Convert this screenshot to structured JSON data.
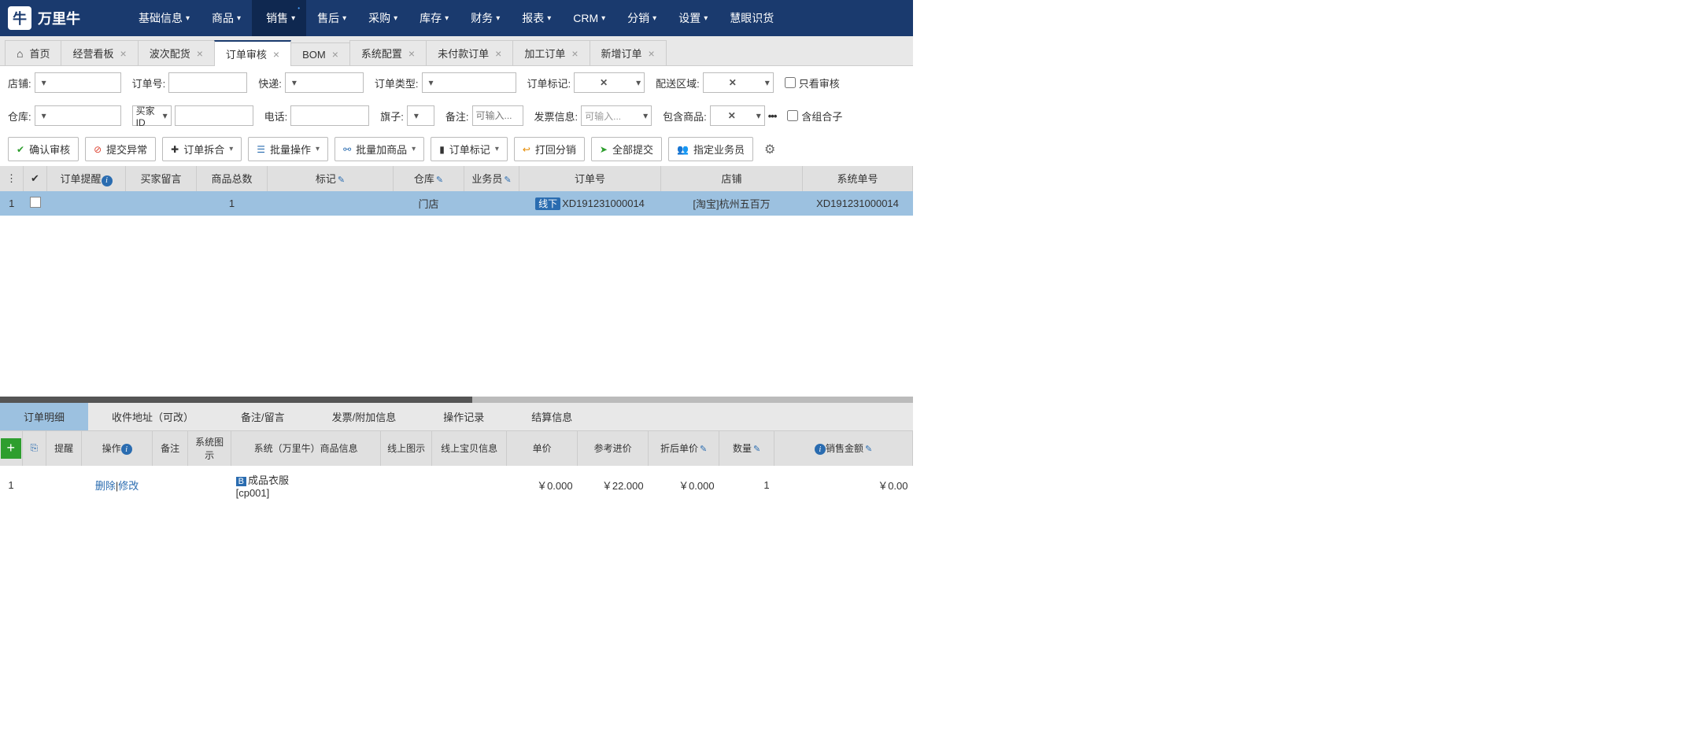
{
  "logo": "万里牛",
  "nav": [
    {
      "label": "基础信息",
      "active": false,
      "dot": false
    },
    {
      "label": "商品",
      "active": false,
      "dot": false
    },
    {
      "label": "销售",
      "active": true,
      "dot": true
    },
    {
      "label": "售后",
      "active": false,
      "dot": false
    },
    {
      "label": "采购",
      "active": false,
      "dot": false
    },
    {
      "label": "库存",
      "active": false,
      "dot": false
    },
    {
      "label": "财务",
      "active": false,
      "dot": false
    },
    {
      "label": "报表",
      "active": false,
      "dot": false
    },
    {
      "label": "CRM",
      "active": false,
      "dot": false
    },
    {
      "label": "分销",
      "active": false,
      "dot": false
    },
    {
      "label": "设置",
      "active": false,
      "dot": false
    },
    {
      "label": "慧眼识货",
      "active": false,
      "dot": false,
      "nocaret": true
    }
  ],
  "tabs": [
    {
      "label": "首页",
      "home": true,
      "closable": false
    },
    {
      "label": "经营看板",
      "closable": true
    },
    {
      "label": "波次配货",
      "closable": true
    },
    {
      "label": "订单审核",
      "closable": true,
      "active": true
    },
    {
      "label": "BOM",
      "closable": true
    },
    {
      "label": "系统配置",
      "closable": true
    },
    {
      "label": "未付款订单",
      "closable": true
    },
    {
      "label": "加工订单",
      "closable": true
    },
    {
      "label": "新增订单",
      "closable": true
    }
  ],
  "filters_row1": {
    "shop": "店铺:",
    "order_no": "订单号:",
    "express": "快递:",
    "order_type": "订单类型:",
    "order_mark": "订单标记:",
    "delivery_area": "配送区域:",
    "only_audit": "只看审核"
  },
  "filters_row2": {
    "warehouse": "仓库:",
    "buyer_id": "买家ID",
    "phone": "电话:",
    "flag": "旗子:",
    "remark": "备注:",
    "remark_ph": "可输入...",
    "invoice": "发票信息:",
    "invoice_ph": "可输入...",
    "include_goods": "包含商品:",
    "include_combo": "含组合子"
  },
  "toolbar": {
    "confirm": "确认审核",
    "abnormal": "提交异常",
    "split": "订单拆合",
    "batch": "批量操作",
    "batch_add": "批量加商品",
    "order_mark": "订单标记",
    "return_dist": "打回分销",
    "submit_all": "全部提交",
    "assign": "指定业务员"
  },
  "main_headers": [
    "",
    "",
    "订单提醒",
    "买家留言",
    "商品总数",
    "标记",
    "仓库",
    "业务员",
    "订单号",
    "店铺",
    "系统单号"
  ],
  "main_row": {
    "idx": "1",
    "qty": "1",
    "warehouse": "门店",
    "badge": "线下",
    "order_no": "XD191231000014",
    "shop": "[淘宝]杭州五百万",
    "sys_no": "XD191231000014"
  },
  "detail_tabs": [
    "订单明细",
    "收件地址（可改）",
    "备注/留言",
    "发票/附加信息",
    "操作记录",
    "结算信息"
  ],
  "detail_headers": [
    "",
    "",
    "提醒",
    "操作",
    "备注",
    "系统图示",
    "系统（万里牛）商品信息",
    "线上图示",
    "线上宝贝信息",
    "单价",
    "参考进价",
    "折后单价",
    "数量",
    "销售金额"
  ],
  "detail_row": {
    "idx": "1",
    "del": "删除",
    "mod": "修改",
    "prod_name": "成品衣服",
    "prod_code": "[cp001]",
    "price": "￥0.000",
    "cost": "￥22.000",
    "disc": "￥0.000",
    "qty": "1",
    "amount": "￥0.00"
  }
}
